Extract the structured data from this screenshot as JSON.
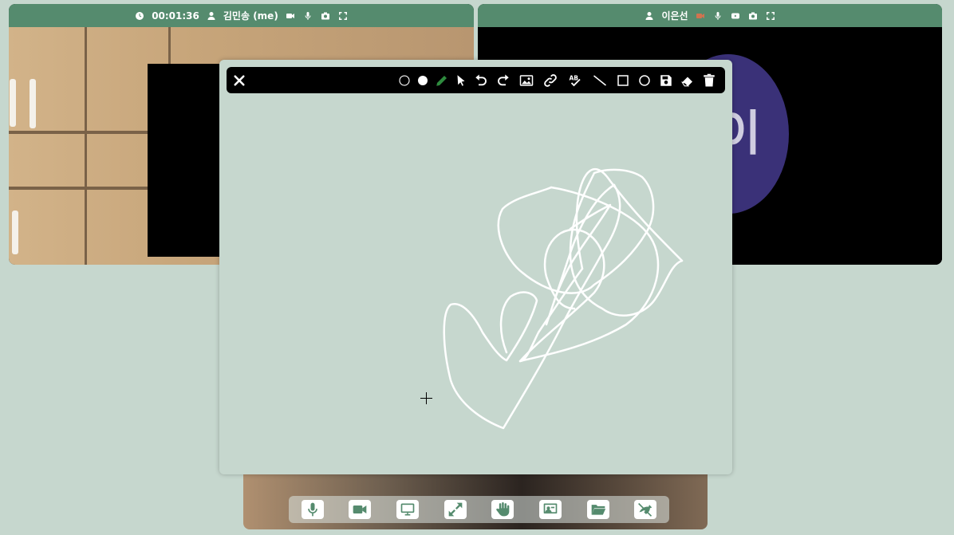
{
  "tiles": [
    {
      "header": {
        "timer": "00:01:36",
        "name": "김민송 (me)",
        "icons": [
          "clock-icon",
          "user-icon",
          "video-camera-icon",
          "microphone-icon",
          "camera-icon",
          "fullscreen-icon"
        ]
      }
    },
    {
      "header": {
        "name": "이은선",
        "icons": [
          "user-icon",
          "video-camera-off-icon",
          "microphone-icon",
          "youtube-icon",
          "camera-icon",
          "fullscreen-icon"
        ]
      },
      "avatar_text": "이"
    }
  ],
  "whiteboard": {
    "toolbar": [
      "close-icon",
      "circle-outline-icon",
      "circle-filled-icon",
      "pencil-icon",
      "pointer-icon",
      "undo-icon",
      "redo-icon",
      "image-icon",
      "link-icon",
      "spellcheck-icon",
      "line-icon",
      "rectangle-icon",
      "circle-icon",
      "save-icon",
      "eraser-icon",
      "trash-icon"
    ],
    "pencil_color": "#2e8b3e",
    "stroke_color": "#ffffff"
  },
  "controls": [
    "microphone-icon",
    "video-camera-icon",
    "monitor-icon",
    "expand-icon",
    "raise-hand-icon",
    "presentation-icon",
    "folder-icon",
    "hang-up-icon"
  ],
  "colors": {
    "background": "#c6d7ce",
    "header": "#558b6e",
    "avatar": "#3a3178",
    "camera_off": "#d0734f"
  }
}
